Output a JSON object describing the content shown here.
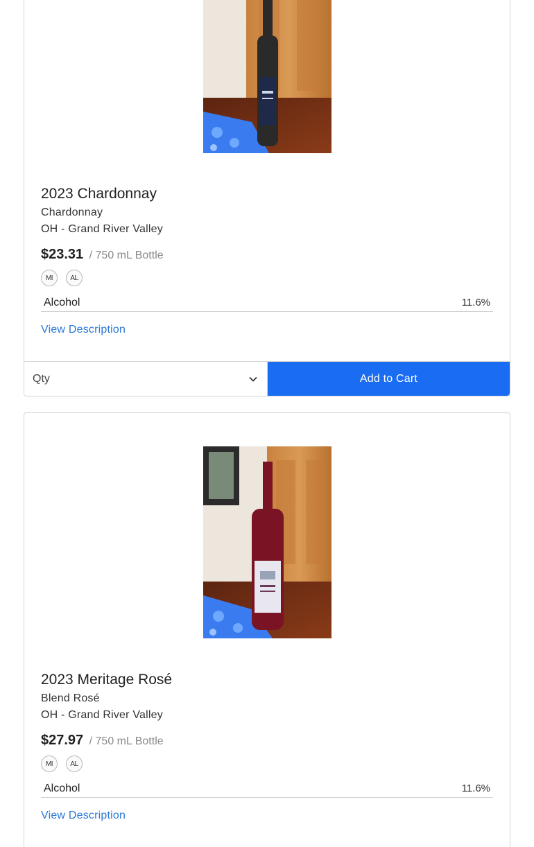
{
  "products": [
    {
      "name": "2023 Chardonnay",
      "varietal": "Chardonnay",
      "region": "OH - Grand River Valley",
      "price": "$23.31",
      "unit": "/ 750 mL Bottle",
      "badges": [
        "MI",
        "AL"
      ],
      "spec_label": "Alcohol",
      "spec_value": "11.6%",
      "view_description": "View Description",
      "qty_placeholder": "Qty",
      "add_to_cart": "Add to Cart",
      "bottle_color": "#2a2a2a"
    },
    {
      "name": "2023 Meritage Rosé",
      "varietal": "Blend Rosé",
      "region": "OH - Grand River Valley",
      "price": "$27.97",
      "unit": "/ 750 mL Bottle",
      "badges": [
        "MI",
        "AL"
      ],
      "spec_label": "Alcohol",
      "spec_value": "11.6%",
      "view_description": "View Description",
      "bottle_color": "#7a1424"
    }
  ],
  "colors": {
    "accent": "#1a6cf2",
    "link": "#2a78d6",
    "border": "#d6d6d6"
  },
  "icons": {
    "select_chevron": "chevron-down-icon"
  }
}
